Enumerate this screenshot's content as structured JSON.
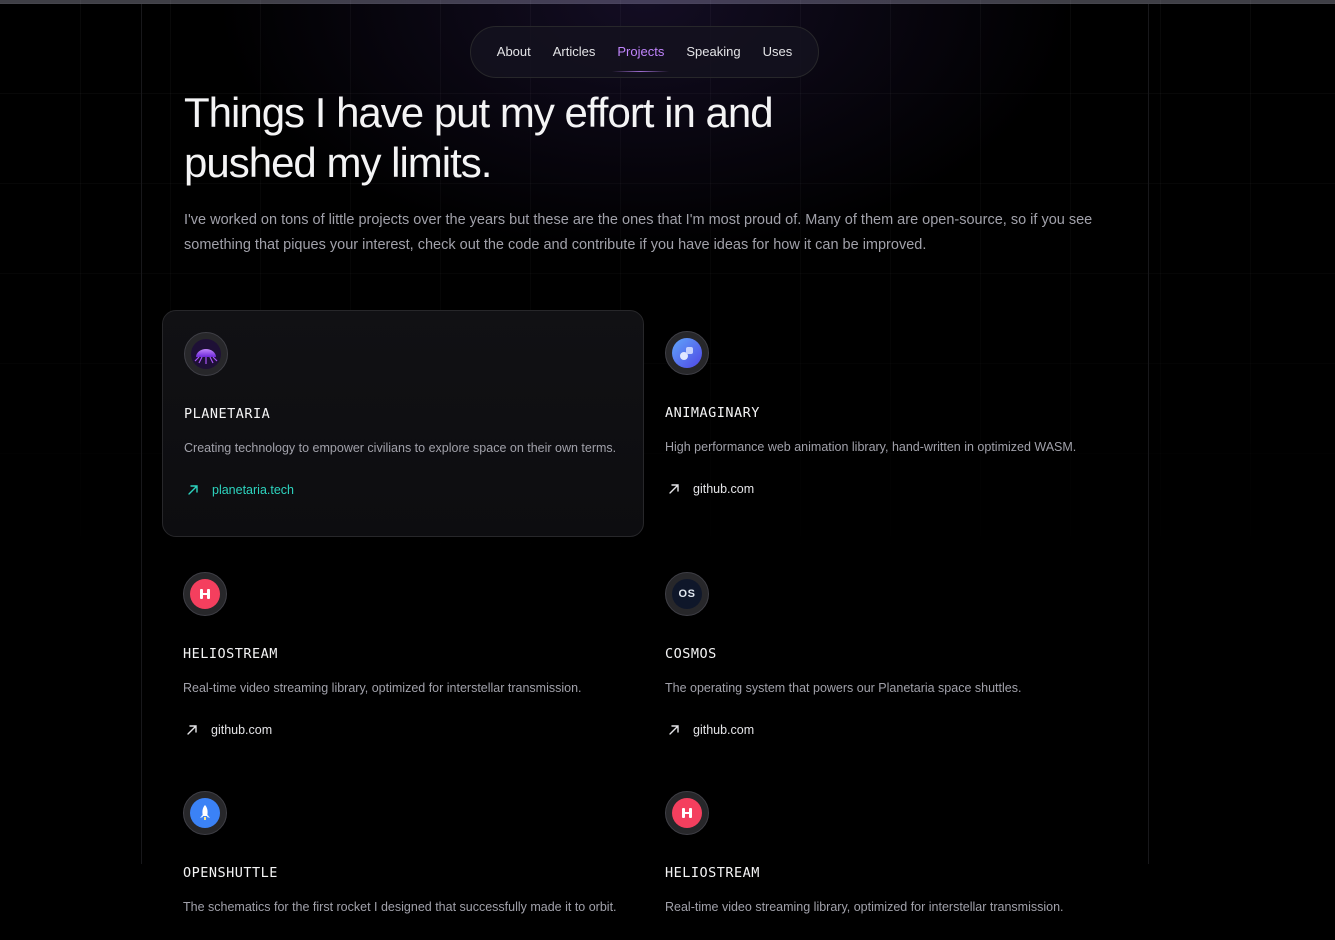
{
  "nav": {
    "items": [
      {
        "label": "About"
      },
      {
        "label": "Articles"
      },
      {
        "label": "Projects"
      },
      {
        "label": "Speaking"
      },
      {
        "label": "Uses"
      }
    ],
    "active": "Projects"
  },
  "hero": {
    "title": "Things I have put my effort in and pushed my limits.",
    "text": "I've worked on tons of little projects over the years but these are the ones that I'm most proud of. Many of them are open-source, so if you see something that piques your interest, check out the code and contribute if you have ideas for how it can be improved."
  },
  "projects": [
    {
      "name": "PLANETARIA",
      "description": "Creating technology to empower civilians to explore space on their own terms.",
      "link": "planetaria.tech",
      "icon": "planetaria-logo-icon"
    },
    {
      "name": "ANIMAGINARY",
      "description": "High performance web animation library, hand-written in optimized WASM.",
      "link": "github.com",
      "icon": "animaginary-logo-icon"
    },
    {
      "name": "HELIOSTREAM",
      "description": "Real-time video streaming library, optimized for interstellar transmission.",
      "link": "github.com",
      "icon": "heliostream-logo-icon"
    },
    {
      "name": "COSMOS",
      "description": "The operating system that powers our Planetaria space shuttles.",
      "link": "github.com",
      "icon": "cosmos-logo-icon",
      "logo_text": "OS"
    },
    {
      "name": "OPENSHUTTLE",
      "description": "The schematics for the first rocket I designed that successfully made it to orbit.",
      "icon": "openshuttle-logo-icon"
    },
    {
      "name": "HELIOSTREAM",
      "description": "Real-time video streaming library, optimized for interstellar transmission.",
      "icon": "heliostream-logo-icon"
    }
  ],
  "colors": {
    "accent": "#c084fc",
    "link_highlight": "#2dd4bf",
    "background": "#000000"
  }
}
